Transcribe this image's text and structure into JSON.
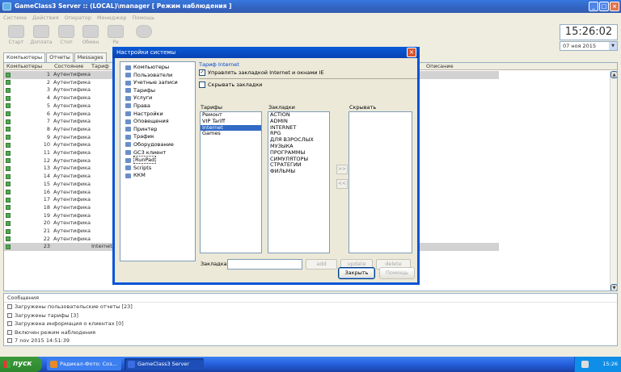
{
  "window": {
    "title": "GameClass3 Server :: (LOCAL)\\manager [ Режим наблюдения ]"
  },
  "menu": [
    "Система",
    "Действия",
    "Оператор",
    "Менеджер",
    "Помощь"
  ],
  "toolbar": [
    "Старт",
    "Доплата",
    "Стоп",
    "Обмен",
    "Ре"
  ],
  "clock": {
    "time": "15:26:02",
    "date": "07 ноя 2015"
  },
  "tabs": [
    "Компьютеры",
    "Отчеты",
    "Messages"
  ],
  "grid": {
    "headers": [
      "Компьютеры",
      "Состояние",
      "Тариф",
      "Описание"
    ],
    "rows": [
      {
        "num": "1",
        "state": "Аутентификац",
        "tariff": ""
      },
      {
        "num": "2",
        "state": "Аутентификац",
        "tariff": ""
      },
      {
        "num": "3",
        "state": "Аутентификац",
        "tariff": ""
      },
      {
        "num": "4",
        "state": "Аутентификац",
        "tariff": ""
      },
      {
        "num": "5",
        "state": "Аутентификац",
        "tariff": ""
      },
      {
        "num": "6",
        "state": "Аутентификац",
        "tariff": ""
      },
      {
        "num": "7",
        "state": "Аутентификац",
        "tariff": ""
      },
      {
        "num": "8",
        "state": "Аутентификац",
        "tariff": ""
      },
      {
        "num": "9",
        "state": "Аутентификац",
        "tariff": ""
      },
      {
        "num": "10",
        "state": "Аутентификац",
        "tariff": ""
      },
      {
        "num": "11",
        "state": "Аутентификац",
        "tariff": ""
      },
      {
        "num": "12",
        "state": "Аутентификац",
        "tariff": ""
      },
      {
        "num": "13",
        "state": "Аутентификац",
        "tariff": ""
      },
      {
        "num": "14",
        "state": "Аутентификац",
        "tariff": ""
      },
      {
        "num": "15",
        "state": "Аутентификац",
        "tariff": ""
      },
      {
        "num": "16",
        "state": "Аутентификац",
        "tariff": ""
      },
      {
        "num": "17",
        "state": "Аутентификац",
        "tariff": ""
      },
      {
        "num": "18",
        "state": "Аутентификац",
        "tariff": ""
      },
      {
        "num": "19",
        "state": "Аутентификац",
        "tariff": ""
      },
      {
        "num": "20",
        "state": "Аутентификац",
        "tariff": ""
      },
      {
        "num": "21",
        "state": "Аутентификац",
        "tariff": ""
      },
      {
        "num": "22",
        "state": "Аутентификац",
        "tariff": ""
      },
      {
        "num": "23",
        "state": "",
        "tariff": "Internet"
      }
    ]
  },
  "messages": {
    "title": "Сообщения",
    "items": [
      "Загружены пользовательские отчеты [23]",
      "Загружены тарифы [3]",
      "Загружена информация о клиентах [0]",
      "Включен режим наблюдения",
      "7 nov 2015 14:51:39"
    ]
  },
  "dialog": {
    "title": "Настройки системы",
    "tree": [
      "Компьютеры",
      "Пользователи",
      "Учетные записи",
      "Тарифы",
      "Услуги",
      "Права",
      "Настройки",
      "Оповещения",
      "Принтер",
      "Трафик",
      "Оборудование",
      "GC3 клиент",
      "RunPad",
      "Scripts",
      "ККМ"
    ],
    "selected_tree": "RunPad",
    "group_title": "Тариф Internet",
    "check_manage": "Управлять закладкой Internet и окнами IE",
    "check_hide": "Скрывать закладки",
    "lbl_tariffs": "Тарифы",
    "lbl_bookmarks": "Закладки",
    "lbl_hide": "Скрывать",
    "tariffs": [
      "Ремонт",
      "VIP Tariff",
      "Internet",
      "Games"
    ],
    "selected_tariff": "Internet",
    "bookmarks": [
      "ACTION",
      "ADMIN",
      "INTERNET",
      "RPG",
      "ДЛЯ ВЗРОСЛЫХ",
      "МУЗЫКА",
      "ПРОГРАММЫ",
      "СИМУЛЯТОРЫ",
      "СТРАТЕГИИ",
      "ФИЛЬМЫ"
    ],
    "move_right": ">>",
    "move_left": "<<",
    "lbl_bookmark": "Закладка",
    "btn_add": "add",
    "btn_update": "update",
    "btn_delete": "delete",
    "btn_close": "Закрыть",
    "btn_help": "Помощь"
  },
  "taskbar": {
    "start": "пуск",
    "tasks": [
      "Радикал-Фото: Соз...",
      "GameClass3 Server"
    ],
    "lang": "EN",
    "time": "15:26"
  }
}
